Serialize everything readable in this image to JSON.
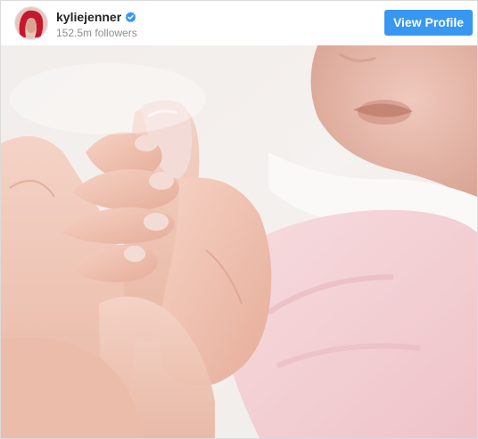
{
  "header": {
    "avatar_icon": "profile-avatar",
    "username": "kyliejenner",
    "verified_icon": "verified-badge-icon",
    "followers": "152.5m followers",
    "view_profile_label": "View Profile"
  },
  "colors": {
    "button": "#3897f0",
    "verified": "#3897f0",
    "username": "#262626",
    "subtext": "#8e8e8e"
  },
  "post": {
    "image_icon": "post-photo"
  }
}
